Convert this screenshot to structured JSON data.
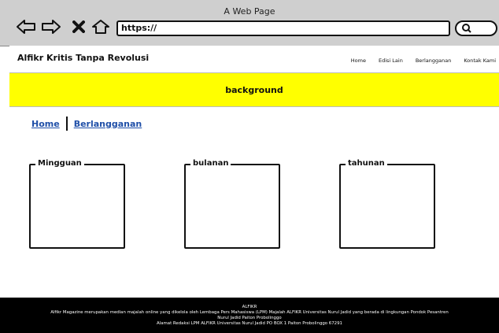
{
  "browser": {
    "title": "A Web Page",
    "url": "https://"
  },
  "header": {
    "site_title": "Alfikr Kritis Tanpa Revolusi",
    "nav": [
      "Home",
      "Edisi Lain",
      "Berlangganan",
      "Kontak Kami"
    ]
  },
  "hero": {
    "label": "background",
    "color": "#ffff00"
  },
  "breadcrumb": {
    "home": "Home",
    "current": "Berlangganan",
    "link_color": "#1f4fa8"
  },
  "plans": [
    "Mingguan",
    "bulanan",
    "tahunan"
  ],
  "footer": {
    "line1": "ALFIKR",
    "line2": "Alfikr Magazine merupakan median majalah online yang dikelola oleh Lembaga Pers Mahasiswa (LPM) Majalah ALFIKR Universitas Nurul Jadid yang berada di lingkungan Pondok Pesantren",
    "line3": "Nurul Jadid Paiton Probolinggo",
    "line4": "Alamat Redaksi LPM ALFIKR Universitas Nurul Jadid PO BOX 1 Paiton Probolinggo 67291"
  }
}
